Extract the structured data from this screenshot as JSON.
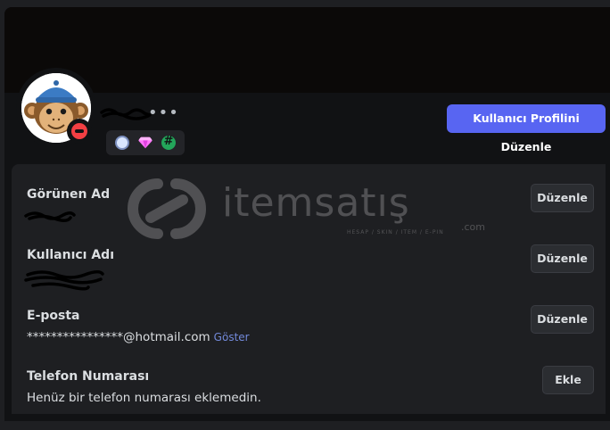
{
  "header": {
    "edit_profile_label": "Kullanıcı Profilini Düzenle",
    "more_dots": "•••"
  },
  "rows": [
    {
      "label": "Görünen Ad",
      "value": "",
      "button": "Düzenle"
    },
    {
      "label": "Kullanıcı Adı",
      "value": "",
      "button": "Düzenle"
    },
    {
      "label": "E-posta",
      "value": "****************@hotmail.com",
      "reveal": "Göster",
      "button": "Düzenle"
    },
    {
      "label": "Telefon Numarası",
      "value": "Henüz bir telefon numarası eklemedin.",
      "button": "Ekle"
    }
  ],
  "watermark": {
    "brand": "itemsatış",
    "tagline": "HESAP / SKIN / ITEM / E-PIN",
    "suffix": ".com"
  },
  "colors": {
    "accent": "#5865f2",
    "status_dnd": "#f23f43",
    "link": "#7289da"
  },
  "icons": [
    "monkey-avatar-icon",
    "dnd-status-icon",
    "active-developer-badge-icon",
    "nitro-gem-badge-icon",
    "hashtag-badge-icon"
  ]
}
